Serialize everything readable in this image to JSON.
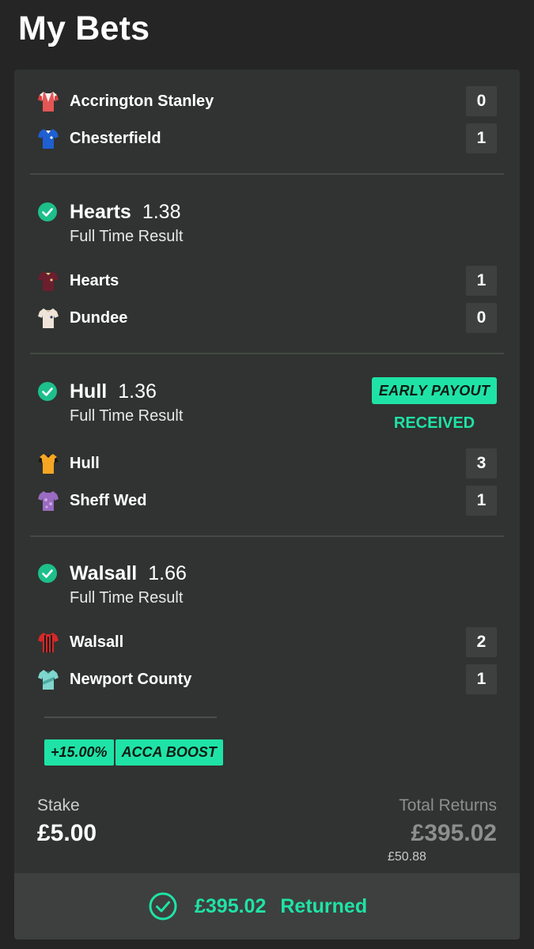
{
  "header": {
    "title": "My Bets"
  },
  "first_match": {
    "home": {
      "team": "Accrington Stanley",
      "score": "0",
      "kit_icon": "red-white-shirt-icon"
    },
    "away": {
      "team": "Chesterfield",
      "score": "1",
      "kit_icon": "blue-shirt-icon"
    }
  },
  "selections": [
    {
      "pick": "Hearts",
      "odds": "1.38",
      "market": "Full Time Result",
      "status_icon": "check-circle-icon",
      "home": {
        "team": "Hearts",
        "score": "1"
      },
      "away": {
        "team": "Dundee",
        "score": "0"
      }
    },
    {
      "pick": "Hull",
      "odds": "1.36",
      "market": "Full Time Result",
      "status_icon": "check-circle-icon",
      "badge": "EARLY PAYOUT",
      "badge_status": "RECEIVED",
      "home": {
        "team": "Hull",
        "score": "3"
      },
      "away": {
        "team": "Sheff Wed",
        "score": "1"
      }
    },
    {
      "pick": "Walsall",
      "odds": "1.66",
      "market": "Full Time Result",
      "status_icon": "check-circle-icon",
      "home": {
        "team": "Walsall",
        "score": "2"
      },
      "away": {
        "team": "Newport County",
        "score": "1"
      }
    }
  ],
  "boost": {
    "percent": "+15.00%",
    "label": "ACCA BOOST"
  },
  "summary": {
    "stake_label": "Stake",
    "stake_value": "£5.00",
    "returns_label": "Total Returns",
    "returns_value": "£395.02",
    "returns_sub": "£50.88"
  },
  "footer": {
    "amount": "£395.02",
    "status": "Returned"
  },
  "colors": {
    "accent": "#1fe3a6",
    "background": "#252525",
    "card": "#303331",
    "score_box": "#3d403e"
  }
}
